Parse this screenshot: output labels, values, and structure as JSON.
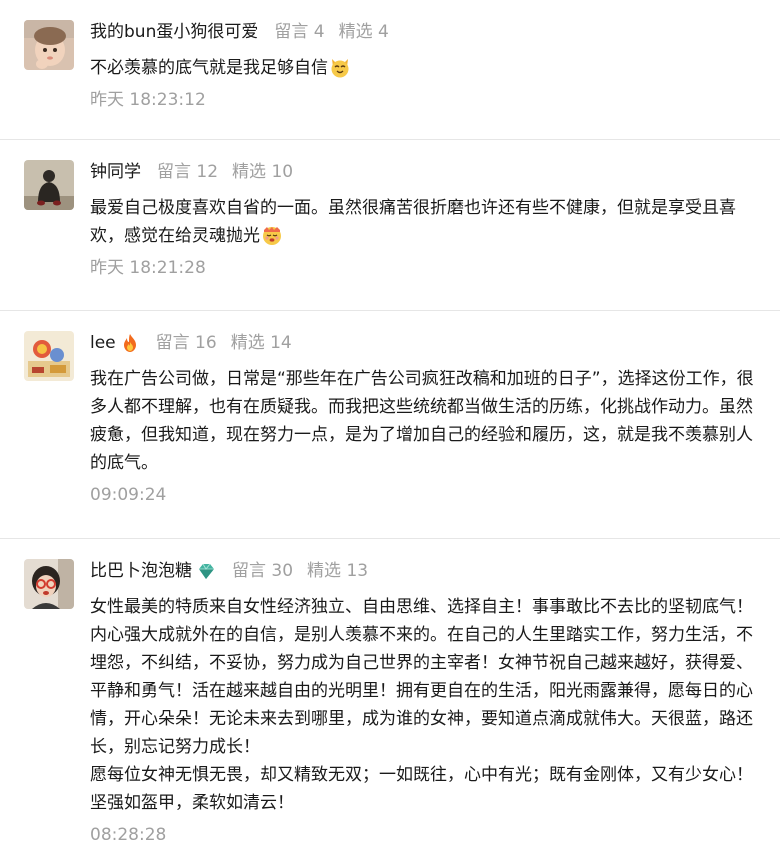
{
  "comments": [
    {
      "nickname": "我的bun蛋小狗很可爱",
      "liuyan": "留言 4",
      "jingxuan": "精选 4",
      "paragraphs": [
        "不必羡慕的底气就是我足够自信"
      ],
      "emoji": "cat-face-emoji",
      "time": "昨天 18:23:12",
      "avatar": "child-photo-avatar"
    },
    {
      "nickname": "钟同学",
      "liuyan": "留言 12",
      "jingxuan": "精选 10",
      "paragraphs": [
        "最爱自己极度喜欢自省的一面。虽然很痛苦很折磨也许还有些不健康，但就是享受且喜欢，感觉在给灵魂抛光"
      ],
      "emoji": "smiling-face-emoji",
      "time": "昨天 18:21:28",
      "avatar": "seated-person-avatar"
    },
    {
      "nickname": "lee",
      "nick_icon": "fire-icon",
      "liuyan": "留言 16",
      "jingxuan": "精选 14",
      "paragraphs": [
        "我在广告公司做，日常是“那些年在广告公司疯狂改稿和加班的日子”，选择这份工作，很多人都不理解，也有在质疑我。而我把这些统统都当做生活的历练，化挑战作动力。虽然疲惫，但我知道，现在努力一点，是为了增加自己的经验和履历，这，就是我不羡慕别人的底气。"
      ],
      "time": "09:09:24",
      "avatar": "toy-figures-avatar"
    },
    {
      "nickname": "比巴卜泡泡糖",
      "nick_icon": "gem-icon",
      "liuyan": "留言 30",
      "jingxuan": "精选 13",
      "paragraphs": [
        "女性最美的特质来自女性经济独立、自由思维、选择自主！事事敢比不去比的坚韧底气！内心强大成就外在的自信，是别人羡慕不来的。在自己的人生里踏实工作，努力生活，不埋怨，不纠结，不妥协，努力成为自己世界的主宰者！女神节祝自己越来越好，获得爱、平静和勇气！活在越来越自由的光明里！拥有更自在的生活，阳光雨露兼得，愿每日的心情，开心朵朵！无论未来去到哪里，成为谁的女神，要知道点滴成就伟大。天很蓝，路还长，别忘记努力成长！",
        "愿每位女神无惧无畏，却又精致无双；一如既往，心中有光；既有金刚体，又有少女心！坚强如盔甲，柔软如清云！"
      ],
      "time": "08:28:28",
      "avatar": "girl-with-glasses-avatar"
    }
  ]
}
